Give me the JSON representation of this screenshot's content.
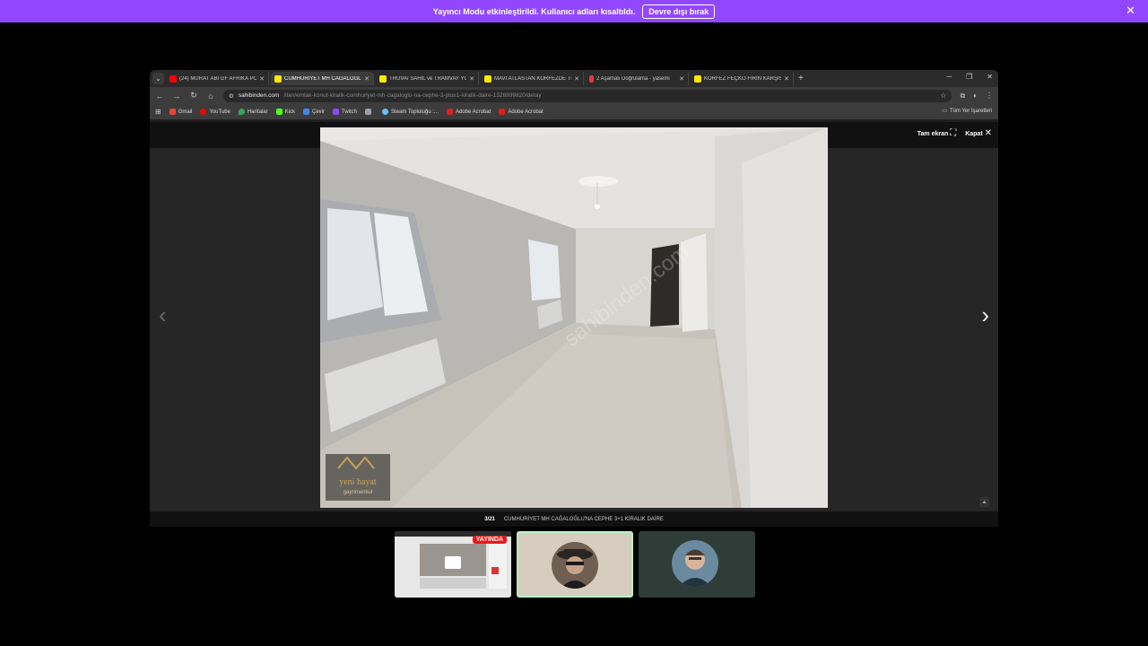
{
  "banner": {
    "text": "Yayıncı Modu etkinleştirildi. Kullanıcı adları kısaltıldı.",
    "button": "Devre dışı bırak"
  },
  "tabs": [
    {
      "title": "(24) MURAT ABİ GF AFRİKA PO",
      "favicon": "youtube-icon"
    },
    {
      "title": "CUMHURİYET MH CAĞALOĞLU'N",
      "favicon": "sahibinden-icon"
    },
    {
      "title": "TRUVA/ SAHİL ve TRAMVAY YÜ",
      "favicon": "sahibinden-icon"
    },
    {
      "title": "MAVİ ATLASTAN KÖRFEZDE TE",
      "favicon": "sahibinden-icon"
    },
    {
      "title": "2 Aşamalı Doğrulama - yasemi",
      "favicon": "doc-icon"
    },
    {
      "title": "KÖRFEZ FEÇKO FIRIN KARŞISI",
      "favicon": "sahibinden-icon"
    }
  ],
  "omnibox": {
    "domain": "sahibinden.com",
    "path": "/ilan/emlak-konut-kiralik-cumhuriyet-mh-cagaloglu-na-cephe-3-plus1-kiralik-daire-1326999820/detay"
  },
  "bookmarks": [
    {
      "label": "Gmail",
      "color": "#ea4335"
    },
    {
      "label": "YouTube",
      "color": "#ff0000"
    },
    {
      "label": "Haritalar",
      "color": "#34a853"
    },
    {
      "label": "Kick",
      "color": "#53fc18"
    },
    {
      "label": "Çevir",
      "color": "#4285f4"
    },
    {
      "label": "Twitch",
      "color": "#9147ff"
    },
    {
      "label": "",
      "color": "#9aa0a6"
    },
    {
      "label": "Steam Topluluğu :...",
      "color": "#66c0f4"
    },
    {
      "label": "Adobe Acrobat",
      "color": "#e21e1e"
    },
    {
      "label": "Adobe Acrobat",
      "color": "#e21e1e"
    }
  ],
  "bookmarks_all": "Tüm Yer İşaretleri",
  "gallery": {
    "fullscreen": "Tam ekran",
    "close": "Kapat",
    "counter": "3/21",
    "caption": "CUMHURİYET MH CAĞALOĞLU'NA CEPHE 3+1 KİRALIK DAİRE",
    "watermark": "sahibinden.com",
    "logo_line1": "yeni hayat",
    "logo_line2": "gayrimenkul"
  },
  "tiles": {
    "live_badge": "YAYINDA"
  }
}
